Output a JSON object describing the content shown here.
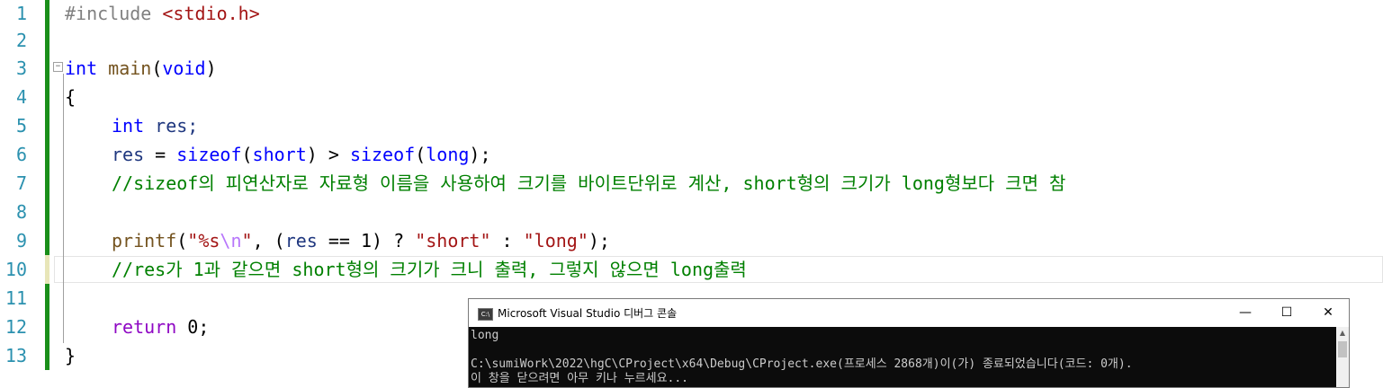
{
  "editor": {
    "line_numbers": [
      "1",
      "2",
      "3",
      "4",
      "5",
      "6",
      "7",
      "8",
      "9",
      "10",
      "11",
      "12",
      "13"
    ],
    "lines": {
      "l1": {
        "directive": "#include",
        "header": "<stdio.h>"
      },
      "l3": {
        "type": "int",
        "name": "main",
        "open": "(",
        "param": "void",
        "close": ")"
      },
      "l4": {
        "text": "{"
      },
      "l5": {
        "type": "int",
        "rest": " res;"
      },
      "l6": {
        "v1": "res",
        "t1": " = ",
        "k1": "sizeof",
        "t2": "(",
        "k2": "short",
        "t3": ") > ",
        "k3": "sizeof",
        "t4": "(",
        "k4": "long",
        "t5": ");"
      },
      "l7": {
        "comment": "//sizeof의 피연산자로 자료형 이름을 사용하여 크기를 바이트단위로 계산, short형의 크기가 long형보다 크면 참"
      },
      "l9": {
        "fn": "printf",
        "t1": "(",
        "s1": "\"%s",
        "esc": "\\n",
        "s2": "\"",
        "t2": ", (",
        "v1": "res",
        "t3": " == ",
        "n1": "1",
        "t4": ") ? ",
        "s3": "\"short\"",
        "t5": " : ",
        "s4": "\"long\"",
        "t6": ");"
      },
      "l10": {
        "comment": "//res가 1과 같으면 short형의 크기가 크니 출력, 그렇지 않으면 long출력"
      },
      "l12": {
        "kw": "return",
        "rest": " 0;"
      },
      "l13": {
        "text": "}"
      }
    },
    "fold_glyph": "−"
  },
  "console": {
    "title": "Microsoft Visual Studio 디버그 콘솔",
    "icon_label": "C:\\",
    "minimize": "—",
    "maximize": "☐",
    "close": "✕",
    "output": [
      "long",
      "",
      "C:\\sumiWork\\2022\\hgC\\CProject\\x64\\Debug\\CProject.exe(프로세스 2868개)이(가) 종료되었습니다(코드: 0개).",
      "이 창을 닫으려면 아무 키나 누르세요..."
    ],
    "scroll_up": "▲"
  },
  "colors": {
    "keyword": "#0000ff",
    "comment": "#008000",
    "string": "#a31515",
    "line_number": "#2b91af",
    "change_saved": "#1a8f1a",
    "console_bg": "#0c0c0c"
  }
}
